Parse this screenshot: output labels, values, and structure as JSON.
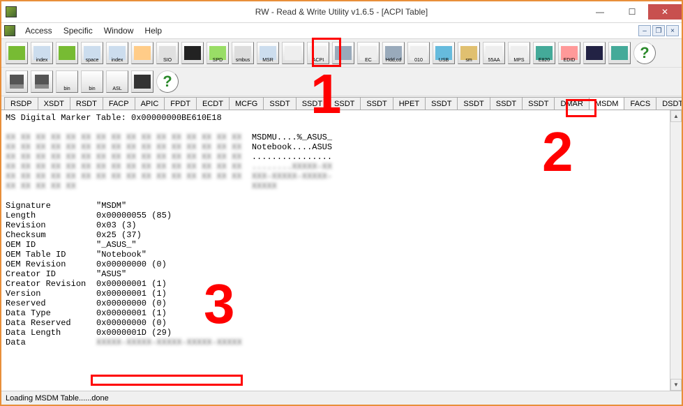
{
  "window": {
    "title": "RW - Read & Write Utility v1.6.5 - [ACPI Table]"
  },
  "menu": {
    "items": [
      "Access",
      "Specific",
      "Window",
      "Help"
    ]
  },
  "toolbar1": [
    {
      "name": "dimm-icon",
      "cap": ""
    },
    {
      "name": "index-icon",
      "cap": "index"
    },
    {
      "name": "dimm2-icon",
      "cap": ""
    },
    {
      "name": "index-space-icon",
      "cap": "space"
    },
    {
      "name": "index2-icon",
      "cap": "index"
    },
    {
      "name": "chip-icon",
      "cap": ""
    },
    {
      "name": "sio-icon",
      "cap": "SIO"
    },
    {
      "name": "wave-icon",
      "cap": ""
    },
    {
      "name": "spd-icon",
      "cap": "SPD"
    },
    {
      "name": "smbus-icon",
      "cap": "smbus"
    },
    {
      "name": "msr-icon",
      "cap": "MSR"
    },
    {
      "name": "doc-icon",
      "cap": ""
    },
    {
      "name": "acpi-icon",
      "cap": "ACPI"
    },
    {
      "name": "hdd-icon",
      "cap": ""
    },
    {
      "name": "ec-icon",
      "cap": "EC"
    },
    {
      "name": "hdd-cd-icon",
      "cap": "Hdd,cd"
    },
    {
      "name": "010-icon",
      "cap": "010"
    },
    {
      "name": "usb-icon",
      "cap": "USB"
    },
    {
      "name": "smbios-icon",
      "cap": "sm"
    },
    {
      "name": "55aa-icon",
      "cap": "55AA"
    },
    {
      "name": "mps-icon",
      "cap": "MPS"
    },
    {
      "name": "e820-icon",
      "cap": "E820"
    },
    {
      "name": "edid-icon",
      "cap": "EDID"
    },
    {
      "name": "cmd-icon",
      "cap": ""
    },
    {
      "name": "monitor-icon",
      "cap": ""
    },
    {
      "name": "help-icon",
      "cap": "?"
    }
  ],
  "toolbar2": [
    {
      "name": "save-icon",
      "cap": ""
    },
    {
      "name": "saveall-icon",
      "cap": ""
    },
    {
      "name": "bin-icon",
      "cap": "bin"
    },
    {
      "name": "bin2-icon",
      "cap": "bin"
    },
    {
      "name": "asl-icon",
      "cap": "ASL"
    },
    {
      "name": "binoculars-icon",
      "cap": ""
    },
    {
      "name": "help-icon",
      "cap": "?"
    }
  ],
  "tabs": [
    "RSDP",
    "XSDT",
    "RSDT",
    "FACP",
    "APIC",
    "FPDT",
    "ECDT",
    "MCFG",
    "SSDT",
    "SSDT",
    "SSDT",
    "SSDT",
    "HPET",
    "SSDT",
    "SSDT",
    "SSDT",
    "SSDT",
    "DMAR",
    "MSDM",
    "FACS",
    "DSDT"
  ],
  "selected_tab": "MSDM",
  "content": {
    "header": "MS Digital Marker Table: 0x00000000BE610E18",
    "hex_rows": [
      {
        "ascii": "MSDMU....%_ASUS_"
      },
      {
        "ascii": "Notebook....ASUS"
      },
      {
        "ascii": "................"
      },
      {
        "ascii": "........XXXXX-XX"
      },
      {
        "ascii": "XXX-XXXXX-XXXXX-"
      },
      {
        "ascii": "XXXXX"
      }
    ],
    "fields": [
      {
        "k": "Signature",
        "v": "\"MSDM\""
      },
      {
        "k": "Length",
        "v": "0x00000055 (85)"
      },
      {
        "k": "Revision",
        "v": "0x03 (3)"
      },
      {
        "k": "Checksum",
        "v": "0x25 (37)"
      },
      {
        "k": "OEM ID",
        "v": "\"_ASUS_\""
      },
      {
        "k": "OEM Table ID",
        "v": "\"Notebook\""
      },
      {
        "k": "OEM Revision",
        "v": "0x00000000 (0)"
      },
      {
        "k": "Creator ID",
        "v": "\"ASUS\""
      },
      {
        "k": "Creator Revision",
        "v": "0x00000001 (1)"
      },
      {
        "k": "Version",
        "v": "0x00000001 (1)"
      },
      {
        "k": "Reserved",
        "v": "0x00000000 (0)"
      },
      {
        "k": "Data Type",
        "v": "0x00000001 (1)"
      },
      {
        "k": "Data Reserved",
        "v": "0x00000000 (0)"
      },
      {
        "k": "Data Length",
        "v": "0x0000001D (29)"
      },
      {
        "k": "Data",
        "v": "XXXXX-XXXXX-XXXXX-XXXXX-XXXXX"
      }
    ]
  },
  "status": "Loading MSDM Table......done",
  "annotations": {
    "num1": "1",
    "num2": "2",
    "num3": "3"
  }
}
